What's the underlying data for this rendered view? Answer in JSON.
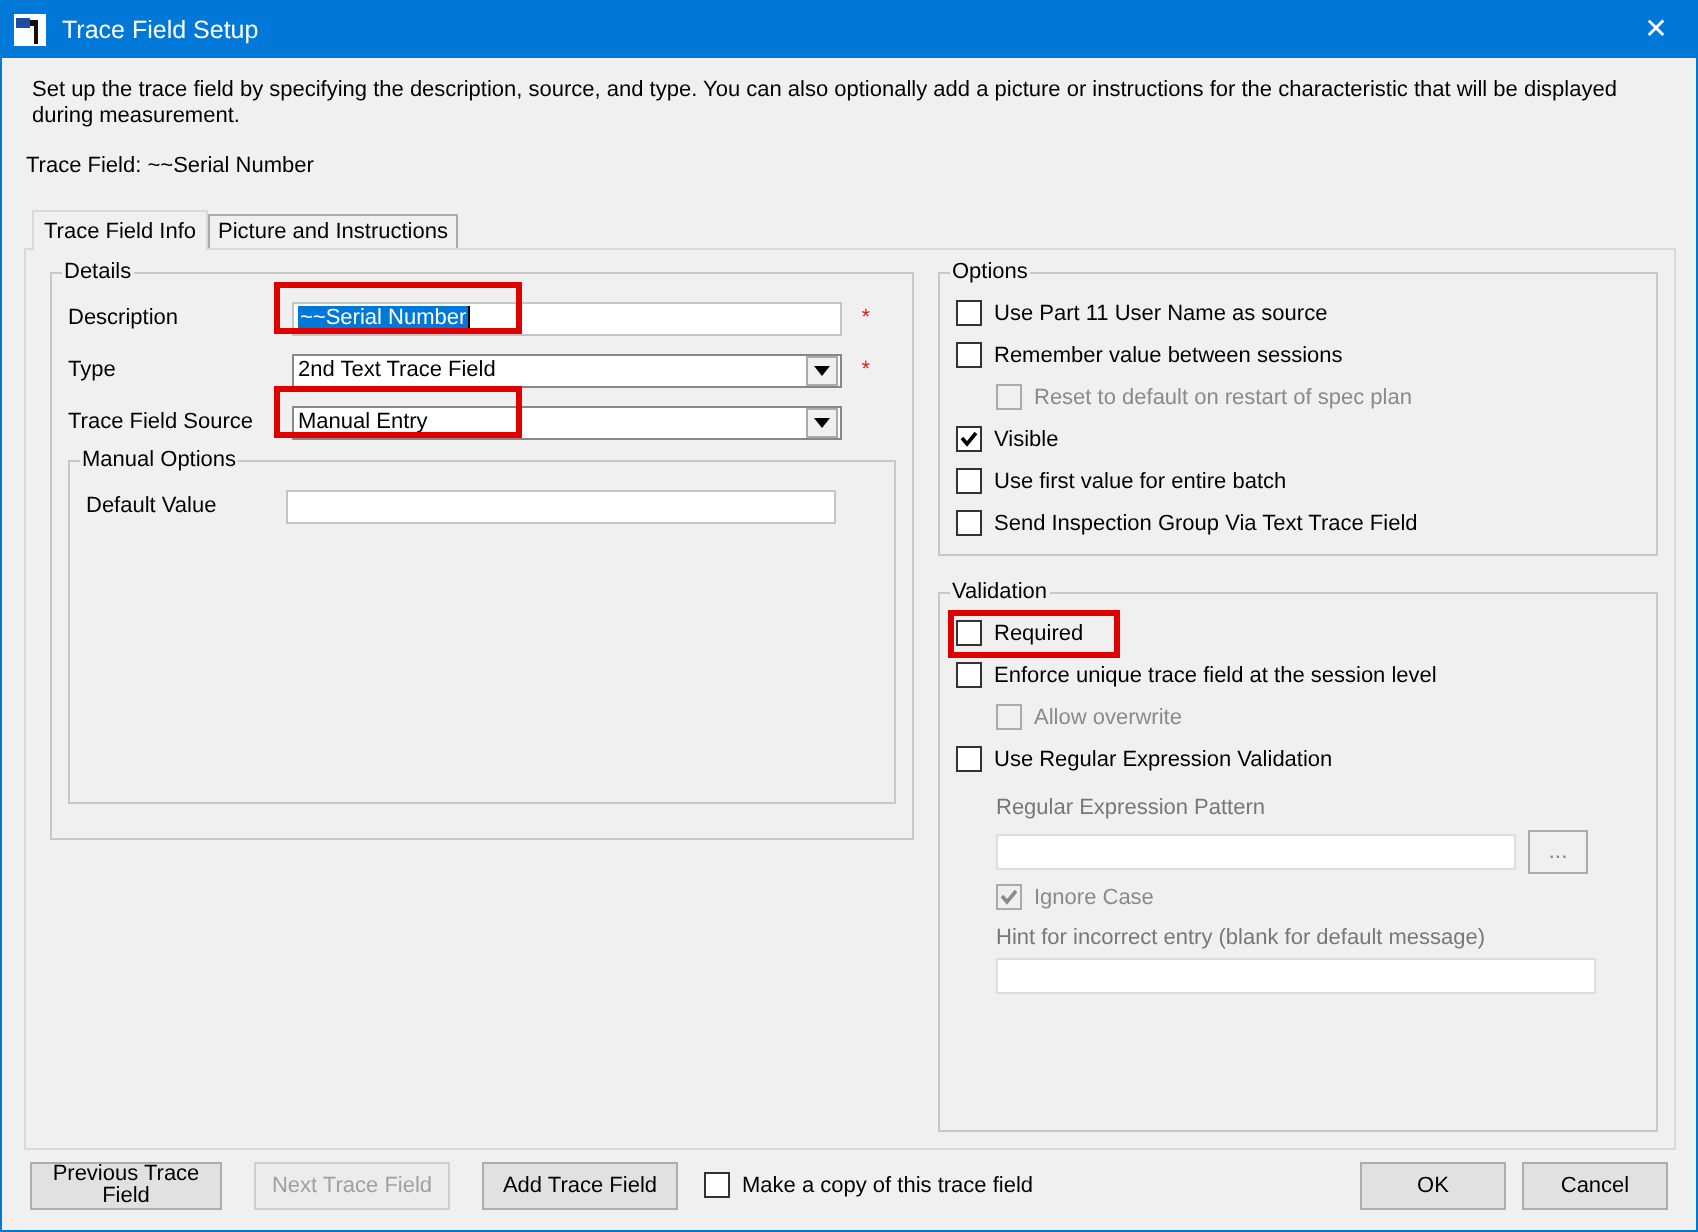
{
  "window": {
    "title": "Trace Field Setup",
    "close": "✕"
  },
  "intro": "Set up the trace field by specifying the description, source, and type. You can also optionally add a picture or instructions for the characteristic that will be displayed during measurement.",
  "trace_field": {
    "label": "Trace Field:",
    "value": "~~Serial Number"
  },
  "tabs": [
    {
      "label": "Trace Field Info",
      "selected": true
    },
    {
      "label": "Picture and Instructions",
      "selected": false
    }
  ],
  "details": {
    "title": "Details",
    "fields": [
      {
        "kind": "text",
        "label": "Description",
        "value": "~~Serial Number",
        "text_selected": true,
        "required": "*",
        "highlighted": true
      },
      {
        "kind": "dropdown",
        "label": "Type",
        "value": "2nd Text Trace Field",
        "required": "*",
        "highlighted": false
      },
      {
        "kind": "dropdown",
        "label": "Trace Field Source",
        "value": "Manual Entry",
        "highlighted": true
      }
    ],
    "manual_options": {
      "title": "Manual Options",
      "label": "Default Value"
    }
  },
  "options": {
    "title": "Options",
    "items": [
      {
        "label": "Use Part 11 User Name as source",
        "checked": false,
        "disabled": false
      },
      {
        "label": "Remember value between sessions",
        "checked": false,
        "disabled": false,
        "children": [
          {
            "label": "Reset to default on restart of spec plan",
            "checked": false,
            "disabled": true
          }
        ]
      },
      {
        "label": "Visible",
        "checked": true,
        "disabled": false
      },
      {
        "label": "Use first value for entire batch",
        "checked": false,
        "disabled": false
      },
      {
        "label": "Send Inspection Group Via Text Trace Field",
        "checked": false,
        "disabled": false
      }
    ]
  },
  "validation": {
    "title": "Validation",
    "items": [
      {
        "label": "Required",
        "checked": false,
        "disabled": false,
        "highlighted": true
      },
      {
        "label": "Enforce unique trace field at the session level",
        "checked": false,
        "disabled": false,
        "children": [
          {
            "label": "Allow overwrite",
            "checked": false,
            "disabled": true
          }
        ]
      },
      {
        "label": "Use Regular Expression Validation",
        "checked": false,
        "disabled": false
      }
    ],
    "pattern_label": "Regular Expression Pattern",
    "browse": "...",
    "ignore_case": {
      "label": "Ignore Case",
      "checked": true,
      "disabled": true
    },
    "hint_label": "Hint for incorrect entry (blank for default message)",
    "disabled": true
  },
  "footer": {
    "buttons": [
      {
        "label": "Previous Trace Field",
        "disabled": false
      },
      {
        "label": "Next Trace Field",
        "disabled": true
      },
      {
        "label": "Add Trace Field",
        "disabled": false
      }
    ],
    "copy": {
      "label": "Make a copy of this trace field",
      "checked": false
    },
    "ok": "OK",
    "cancel": "Cancel"
  }
}
